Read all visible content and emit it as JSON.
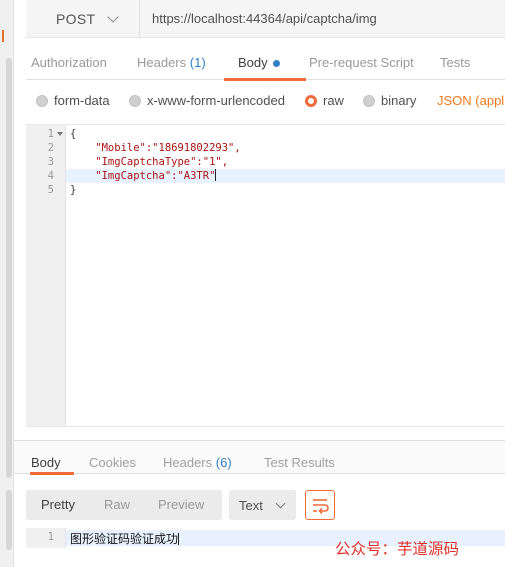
{
  "request": {
    "method": "POST",
    "url": "https://localhost:44364/api/captcha/img"
  },
  "request_tabs": [
    {
      "label": "Authorization",
      "count": ""
    },
    {
      "label": "Headers",
      "count": "(1)"
    },
    {
      "label": "Body",
      "count": ""
    },
    {
      "label": "Pre-request Script",
      "count": ""
    },
    {
      "label": "Tests",
      "count": ""
    }
  ],
  "body_types": {
    "options": [
      "form-data",
      "x-www-form-urlencoded",
      "raw",
      "binary"
    ],
    "selected": "raw",
    "content_type": "JSON (applic"
  },
  "editor": {
    "line_numbers": [
      "1",
      "2",
      "3",
      "4",
      "5"
    ],
    "lines": [
      "{",
      "    \"Mobile\":\"18691802293\",",
      "    \"ImgCaptchaType\":\"1\",",
      "    \"ImgCaptcha\":\"A3TR\"",
      "}"
    ],
    "current_line": 4
  },
  "response_tabs": [
    {
      "label": "Body",
      "count": ""
    },
    {
      "label": "Cookies",
      "count": ""
    },
    {
      "label": "Headers",
      "count": "(6)"
    },
    {
      "label": "Test Results",
      "count": ""
    }
  ],
  "response_view": {
    "modes": [
      "Pretty",
      "Raw",
      "Preview"
    ],
    "active_mode": "Pretty",
    "format": "Text"
  },
  "response_body": {
    "line_number": "1",
    "text": "图形验证码验证成功"
  },
  "watermark": "公众号：芋道源码",
  "colors": {
    "accent": "#f26b3a",
    "blue": "#2f7fc4",
    "json_type": "#f07a1e",
    "watermark": "#e0302a"
  }
}
